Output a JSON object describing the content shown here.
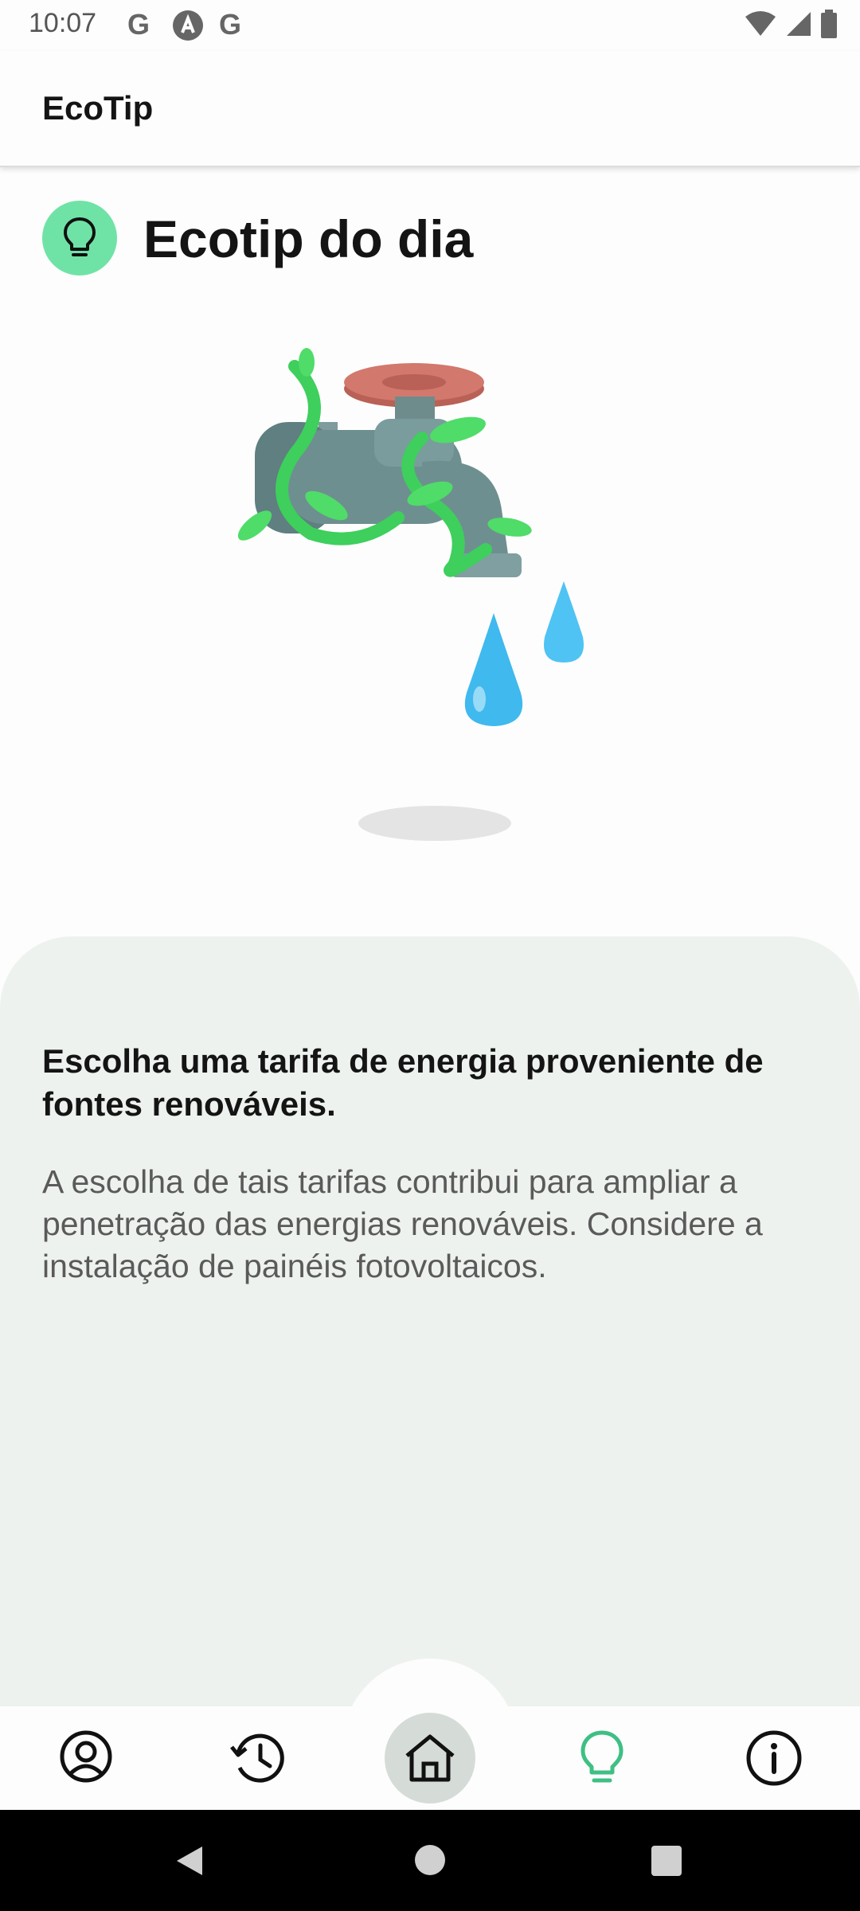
{
  "status_bar": {
    "time": "10:07",
    "notification_icons": [
      "google-g-icon",
      "arch-a-icon",
      "google-g-icon"
    ],
    "g_letter": "G",
    "right_icons": [
      "wifi-icon",
      "cellular-signal-icon",
      "battery-icon"
    ]
  },
  "app_bar": {
    "title": "EcoTip"
  },
  "tip": {
    "heading": "Ecotip do dia",
    "icon": "lightbulb-icon",
    "illustration": "faucet-with-leaves-and-water-drops",
    "title": "Escolha uma tarifa de energia proveniente de fontes renováveis.",
    "body": "A escolha de tais tarifas contribui para ampliar a penetração das energias renováveis. Considere a instalação de painéis fotovoltaicos."
  },
  "bottom_nav": {
    "items": [
      {
        "icon": "profile-icon",
        "selected": false
      },
      {
        "icon": "history-icon",
        "selected": false
      },
      {
        "icon": "home-icon",
        "selected": false,
        "highlighted": true
      },
      {
        "icon": "lightbulb-icon",
        "selected": true
      },
      {
        "icon": "info-icon",
        "selected": false
      }
    ]
  },
  "colors": {
    "accent_green": "#6fe3a6",
    "selected_nav": "#3fbf84",
    "card_background": "#eef2ef",
    "home_highlight": "#d5dcd8"
  },
  "system_nav": {
    "buttons": [
      "back-icon",
      "home-circle-icon",
      "recents-icon"
    ]
  }
}
